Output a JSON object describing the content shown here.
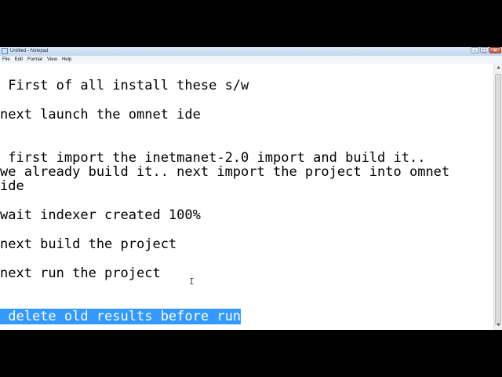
{
  "window": {
    "title": "Untitled - Notepad",
    "minimize_glyph": "–",
    "maximize_glyph": "□",
    "close_glyph": "✕"
  },
  "menu": {
    "items": [
      "File",
      "Edit",
      "Format",
      "View",
      "Help"
    ]
  },
  "document": {
    "lines": [
      " First of all install these s/w",
      "next launch the omnet ide",
      " first import the inetmanet-2.0 import and build it..",
      "we already build it.. next import the project into omnet",
      "ide",
      "wait indexer created 100%",
      "next build the project",
      "next run the project",
      " delete old results before run"
    ]
  },
  "scrollbar": {
    "up_glyph": "▲",
    "down_glyph": "▼"
  },
  "cursor": {
    "glyph": "I"
  },
  "colors": {
    "selection": "#3399ff",
    "background_frame": "#000000"
  },
  "icons": [
    "notepad-app-icon",
    "minimize-icon",
    "maximize-icon",
    "close-icon",
    "scroll-up-icon",
    "scroll-down-icon",
    "ibeam-cursor-icon"
  ]
}
